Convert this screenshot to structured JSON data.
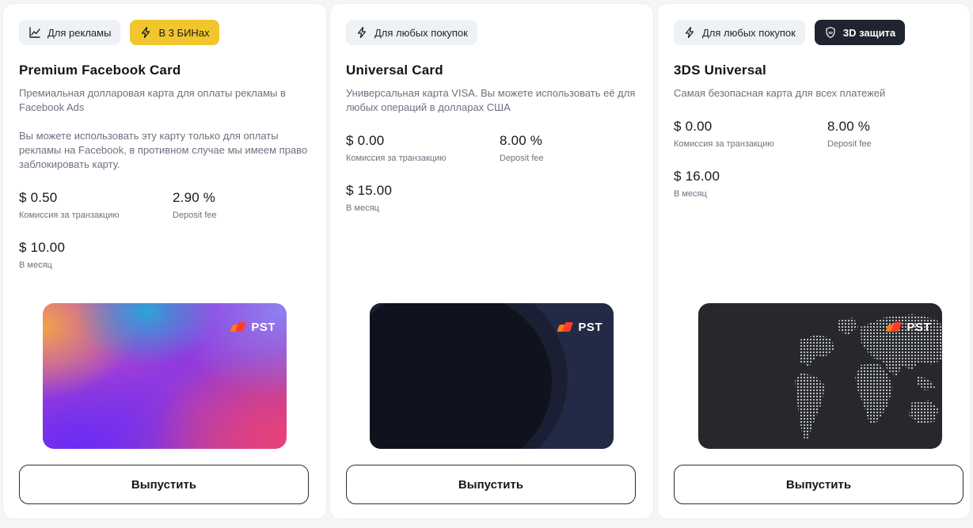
{
  "cards": [
    {
      "tags": [
        {
          "label": "Для рекламы",
          "icon": "trending-up-icon"
        },
        {
          "label": "В 3 БИНах",
          "icon": "lightning-icon"
        }
      ],
      "title": "Premium Facebook Card",
      "description": "Премиальная долларовая карта для оплаты рекламы в Facebook Ads",
      "description2": "Вы можете использовать эту карту только для оплаты рекламы на Facebook, в противном случае мы имеем право заблокировать карту.",
      "fee_value": "$ 0.50",
      "fee_label": "Комиссия за транзакцию",
      "deposit_value": "2.90 %",
      "deposit_label": "Deposit fee",
      "monthly_value": "$ 10.00",
      "monthly_label": "В месяц",
      "logo": "PST",
      "button": "Выпустить"
    },
    {
      "tags": [
        {
          "label": "Для любых покупок",
          "icon": "lightning-icon"
        }
      ],
      "title": "Universal Card",
      "description": "Универсальная карта VISA. Вы можете использовать её для любых операций в долларах США",
      "fee_value": "$ 0.00",
      "fee_label": "Комиссия за транзакцию",
      "deposit_value": "8.00 %",
      "deposit_label": "Deposit fee",
      "monthly_value": "$ 15.00",
      "monthly_label": "В месяц",
      "logo": "PST",
      "button": "Выпустить"
    },
    {
      "tags": [
        {
          "label": "Для любых покупок",
          "icon": "lightning-icon"
        },
        {
          "label": "3D защита",
          "icon": "shield-3d-icon"
        }
      ],
      "title": "3DS Universal",
      "description": "Самая безопасная карта для всех платежей",
      "fee_value": "$ 0.00",
      "fee_label": "Комиссия за транзакцию",
      "deposit_value": "8.00 %",
      "deposit_label": "Deposit fee",
      "monthly_value": "$ 16.00",
      "monthly_label": "В месяц",
      "logo": "PST",
      "button": "Выпустить"
    }
  ],
  "colors": {
    "accent_yellow": "#f0c52e",
    "dark_badge": "#1f2430",
    "tag_bg": "#eef1f5",
    "muted_text": "#6b7280"
  }
}
